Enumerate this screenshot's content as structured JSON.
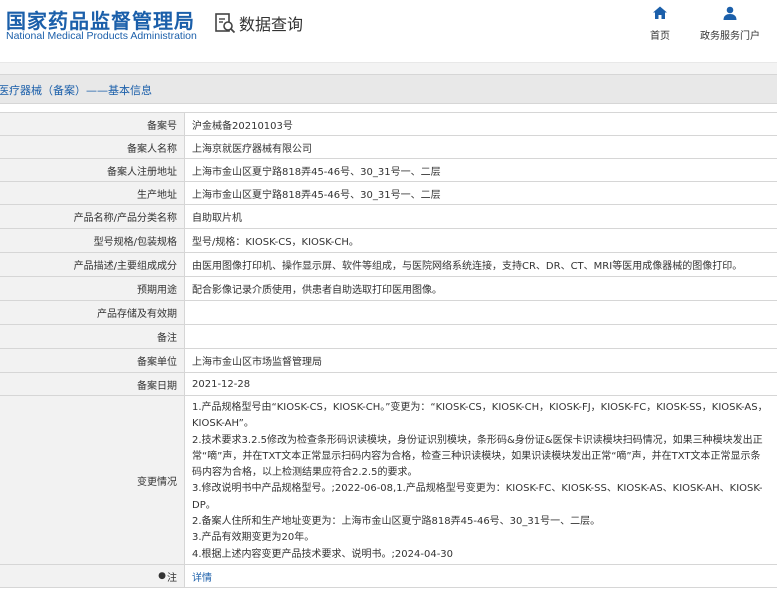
{
  "header": {
    "logo_cn": "国家药品监督管理局",
    "logo_en": "National Medical Products Administration",
    "query_label": "数据查询",
    "nav": [
      {
        "label": "首页",
        "icon": "home-icon"
      },
      {
        "label": "政务服务门户",
        "icon": "user-icon"
      }
    ]
  },
  "section": {
    "title": "医疗器械（备案）——基本信息"
  },
  "rows": [
    {
      "label": "备案号",
      "value": "沪金械备20210103号"
    },
    {
      "label": "备案人名称",
      "value": "上海京就医疗器械有限公司"
    },
    {
      "label": "备案人注册地址",
      "value": "上海市金山区夏宁路818弄45-46号、30_31号一、二层"
    },
    {
      "label": "生产地址",
      "value": "上海市金山区夏宁路818弄45-46号、30_31号一、二层"
    },
    {
      "label": "产品名称/产品分类名称",
      "value": "自助取片机"
    },
    {
      "label": "型号规格/包装规格",
      "value": "型号/规格：KIOSK-CS，KIOSK-CH。"
    },
    {
      "label": "产品描述/主要组成成分",
      "value": "由医用图像打印机、操作显示屏、软件等组成，与医院网络系统连接，支持CR、DR、CT、MRI等医用成像器械的图像打印。"
    },
    {
      "label": "预期用途",
      "value": "配合影像记录介质使用，供患者自助选取打印医用图像。"
    },
    {
      "label": "产品存储及有效期",
      "value": ""
    },
    {
      "label": "备注",
      "value": ""
    },
    {
      "label": "备案单位",
      "value": "上海市金山区市场监督管理局"
    },
    {
      "label": "备案日期",
      "value": "2021-12-28"
    }
  ],
  "changes": {
    "label": "变更情况",
    "lines": [
      "1.产品规格型号由“KIOSK-CS，KIOSK-CH。”变更为：“KIOSK-CS，KIOSK-CH，KIOSK-FJ，KIOSK-FC，KIOSK-SS，KIOSK-AS，KIOSK-AH”。",
      "2.技术要求3.2.5修改为检查条形码识读模块，身份证识别模块，条形码&身份证&医保卡识读模块扫码情况，如果三种模块发出正常“嘀”声，并在TXT文本正常显示扫码内容为合格，检查三种识读模块，如果识读模块发出正常“嘀”声，并在TXT文本正常显示条码内容为合格，以上检测结果应符合2.2.5的要求。",
      "3.修改说明书中产品规格型号。;2022-06-08,1.产品规格型号变更为：KIOSK-FC、KIOSK-SS、KIOSK-AS、KIOSK-AH、KIOSK-DP。",
      "2.备案人住所和生产地址变更为：上海市金山区夏宁路818弄45-46号、30_31号一、二层。",
      "3.产品有效期变更为20年。",
      "4.根据上述内容变更产品技术要求、说明书。;2024-04-30"
    ]
  },
  "note": {
    "label": "注",
    "link": "详情"
  }
}
